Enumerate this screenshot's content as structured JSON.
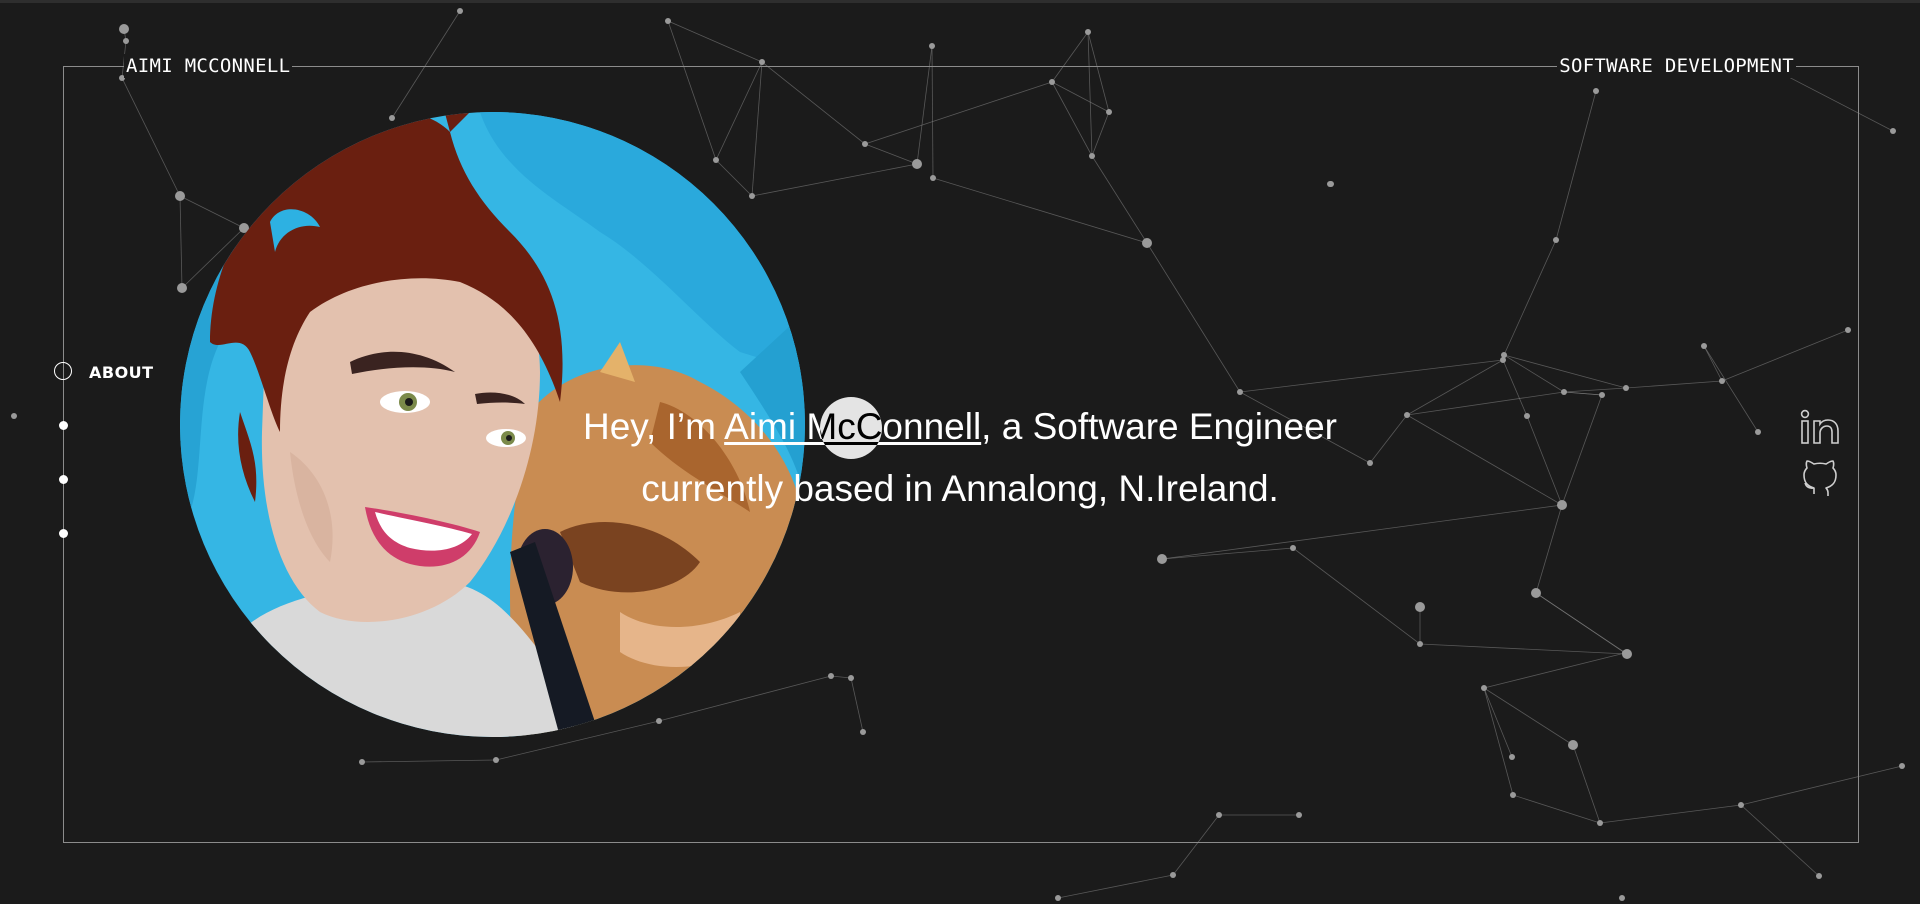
{
  "header": {
    "brand": "AIMI MCCONNELL",
    "tagline": "SOFTWARE DEVELOPMENT"
  },
  "side_nav": {
    "items": [
      {
        "label": "ABOUT",
        "active": true
      },
      {
        "label": "",
        "active": false
      },
      {
        "label": "",
        "active": false
      },
      {
        "label": "",
        "active": false
      }
    ]
  },
  "hero": {
    "greeting": "Hey, I’m ",
    "name": "Aimi McConnell",
    "role_text": ", a Software Engineer",
    "location_text": "currently based in Annalong, N.Ireland."
  },
  "avatar": {
    "description_icon": "portrait-illustration-icon"
  },
  "social": {
    "items": [
      {
        "icon": "linkedin-icon"
      },
      {
        "icon": "github-icon"
      }
    ]
  },
  "colors": {
    "background": "#1b1b1b",
    "frame": "#8c8c8c",
    "network": "#8a8a8a",
    "avatar_sky": "#35b6e4",
    "avatar_hair": "#6a1f10",
    "avatar_skin": "#e3c1ae",
    "avatar_dog": "#c98c52"
  }
}
